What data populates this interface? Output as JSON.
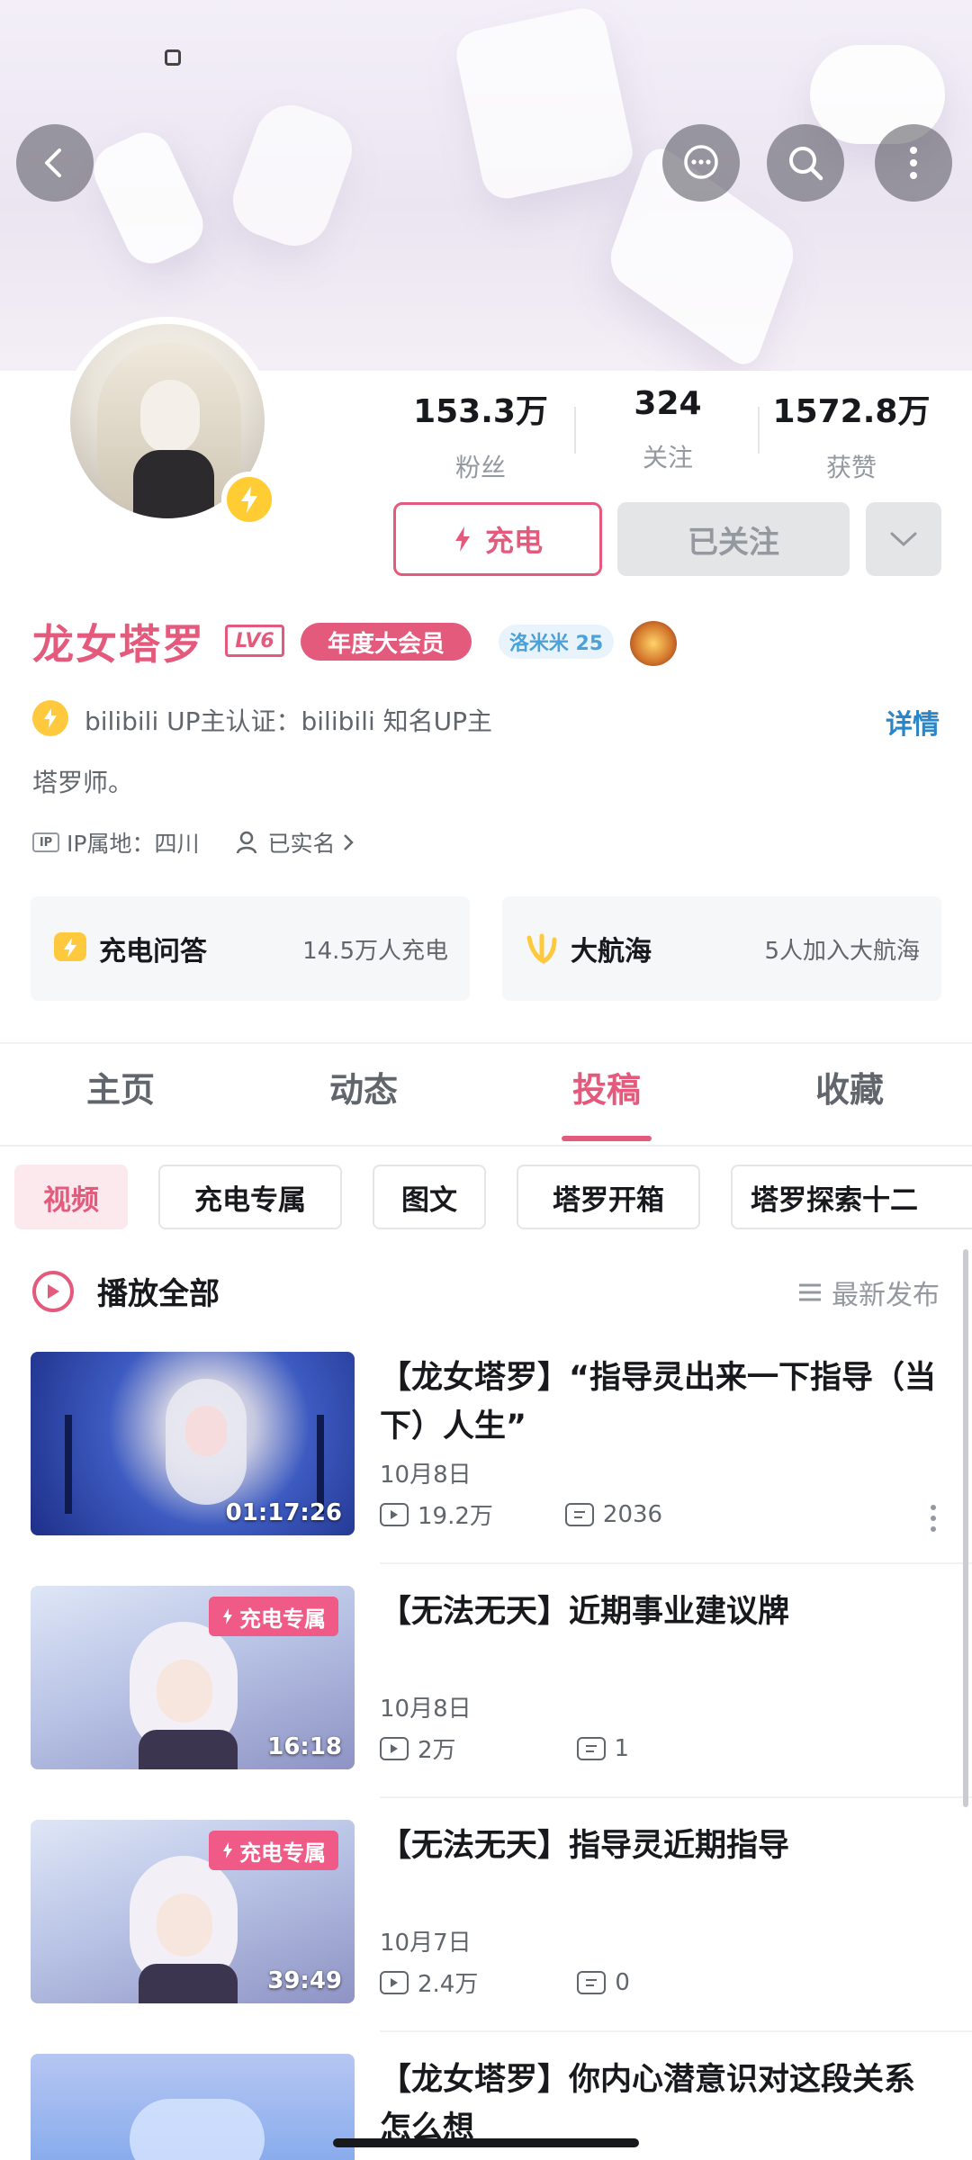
{
  "header": {
    "back": "back-arrow",
    "actions": [
      "chat-icon",
      "search-icon",
      "more-icon"
    ]
  },
  "profile": {
    "name": "龙女塔罗",
    "level": "LV6",
    "vip": "年度大会员",
    "fan_badge": "洛米米 25",
    "stats": [
      {
        "value": "153.3万",
        "label": "粉丝"
      },
      {
        "value": "324",
        "label": "关注"
      },
      {
        "value": "1572.8万",
        "label": "获赞"
      }
    ],
    "charge_label": "充电",
    "followed_label": "已关注",
    "certification": "bilibili UP主认证：bilibili 知名UP主",
    "detail_link": "详情",
    "signature": "塔罗师。",
    "ip": "IP属地：四川",
    "ip_tag": "IP",
    "verified": "已实名"
  },
  "cards": [
    {
      "title": "充电问答",
      "meta": "14.5万人充电"
    },
    {
      "title": "大航海",
      "meta": "5人加入大航海"
    }
  ],
  "tabs": [
    "主页",
    "动态",
    "投稿",
    "收藏"
  ],
  "active_tab": "投稿",
  "chips": [
    "视频",
    "充电专属",
    "图文",
    "塔罗开箱",
    "塔罗探索十二"
  ],
  "play_all": "播放全部",
  "sort_label": "最新发布",
  "videos": [
    {
      "title": "【龙女塔罗】“指导灵出来一下指导（当下）人生”",
      "date": "10月8日",
      "plays": "19.2万",
      "comments": "2036",
      "duration": "01:17:26",
      "exclusive": ""
    },
    {
      "title": "【无法无天】近期事业建议牌",
      "date": "10月8日",
      "plays": "2万",
      "comments": "1",
      "duration": "16:18",
      "exclusive": "充电专属"
    },
    {
      "title": "【无法无天】指导灵近期指导",
      "date": "10月7日",
      "plays": "2.4万",
      "comments": "0",
      "duration": "39:49",
      "exclusive": "充电专属"
    },
    {
      "title": "【龙女塔罗】你内心潜意识对这段关系怎么想",
      "date": "",
      "plays": "",
      "comments": "",
      "duration": "",
      "exclusive": ""
    }
  ],
  "colors": {
    "accent": "#e35a7c",
    "link": "#2a86c8",
    "gold": "#ffc93d"
  }
}
